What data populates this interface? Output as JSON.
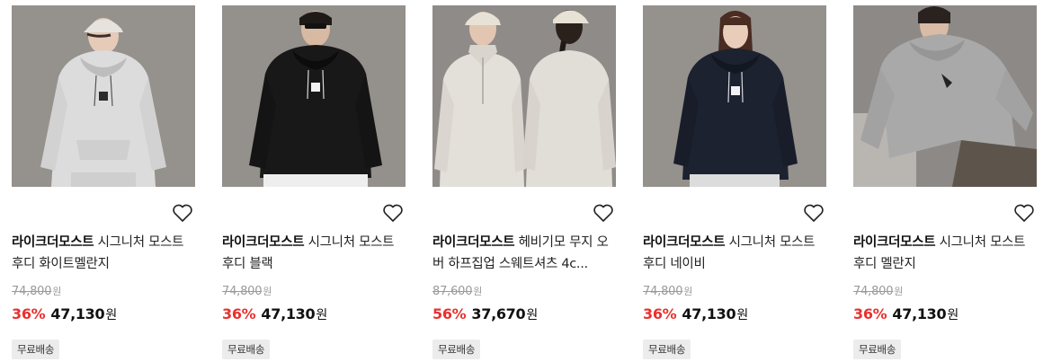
{
  "currency_unit": "원",
  "products": [
    {
      "brand": "라이크더모스트",
      "name": "시그니처 모스트 후디 화이트멜란지",
      "original_price": "74,800",
      "discount_rate": "36%",
      "sale_price": "47,130",
      "badge": "무료배송",
      "image": "hoodie-white-melange-model",
      "liked": false
    },
    {
      "brand": "라이크더모스트",
      "name": "시그니처 모스트 후디 블랙",
      "original_price": "74,800",
      "discount_rate": "36%",
      "sale_price": "47,130",
      "badge": "무료배송",
      "image": "hoodie-black-model",
      "liked": false
    },
    {
      "brand": "라이크더모스트",
      "name": "헤비기모 무지 오버 하프집업 스웨트셔츠 4c...",
      "original_price": "87,600",
      "discount_rate": "56%",
      "sale_price": "37,670",
      "badge": "무료배송",
      "image": "half-zip-sweatshirt-oatmeal-models",
      "liked": false
    },
    {
      "brand": "라이크더모스트",
      "name": "시그니처 모스트 후디 네이비",
      "original_price": "74,800",
      "discount_rate": "36%",
      "sale_price": "47,130",
      "badge": "무료배송",
      "image": "hoodie-navy-model",
      "liked": false
    },
    {
      "brand": "라이크더모스트",
      "name": "시그니처 모스트 후디 멜란지",
      "original_price": "74,800",
      "discount_rate": "36%",
      "sale_price": "47,130",
      "badge": "무료배송",
      "image": "hoodie-grey-melange-model",
      "liked": false
    }
  ],
  "colors": {
    "discount": "#e8312f",
    "original_price": "#9a9a9a",
    "badge_bg": "#ececec",
    "photo_bg": "#8f8b88"
  }
}
